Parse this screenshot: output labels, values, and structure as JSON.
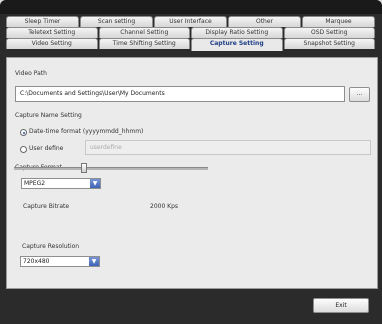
{
  "tabs": {
    "row1": [
      "Sleep Timer",
      "Scan setting",
      "User Interface",
      "Other",
      "Marquee"
    ],
    "row2": [
      "Teletext Setting",
      "Channel Setting",
      "Display Ratio Setting",
      "OSD Setting"
    ],
    "row3": [
      "Video Setting",
      "Time Shifting Setting",
      "Capture Setting",
      "Snapshot Setting"
    ],
    "active": "Capture Setting"
  },
  "capture": {
    "video_path_label": "Video Path",
    "video_path_value": "C:\\Documents and Settings\\User\\My Documents",
    "browse_label": "...",
    "name_setting_label": "Capture Name Setting",
    "option_datetime": "Date-time format (yyyymmdd_hhmm)",
    "option_user": "User define",
    "user_define_value": "userdefine",
    "selected_option": "datetime",
    "format_label": "Capture Format",
    "format_value": "MPEG2",
    "bitrate_label": "Capture Bitrate",
    "bitrate_value": "2000 Kps",
    "bitrate_fraction": 0.36,
    "resolution_label": "Capture Resolution",
    "resolution_value": "720x480"
  },
  "footer": {
    "exit_label": "Exit"
  },
  "icons": {
    "dropdown": "chevron-down-icon"
  },
  "colors": {
    "active_tab_text": "#1d3c86",
    "dropdown_button": "#3f63b8"
  }
}
